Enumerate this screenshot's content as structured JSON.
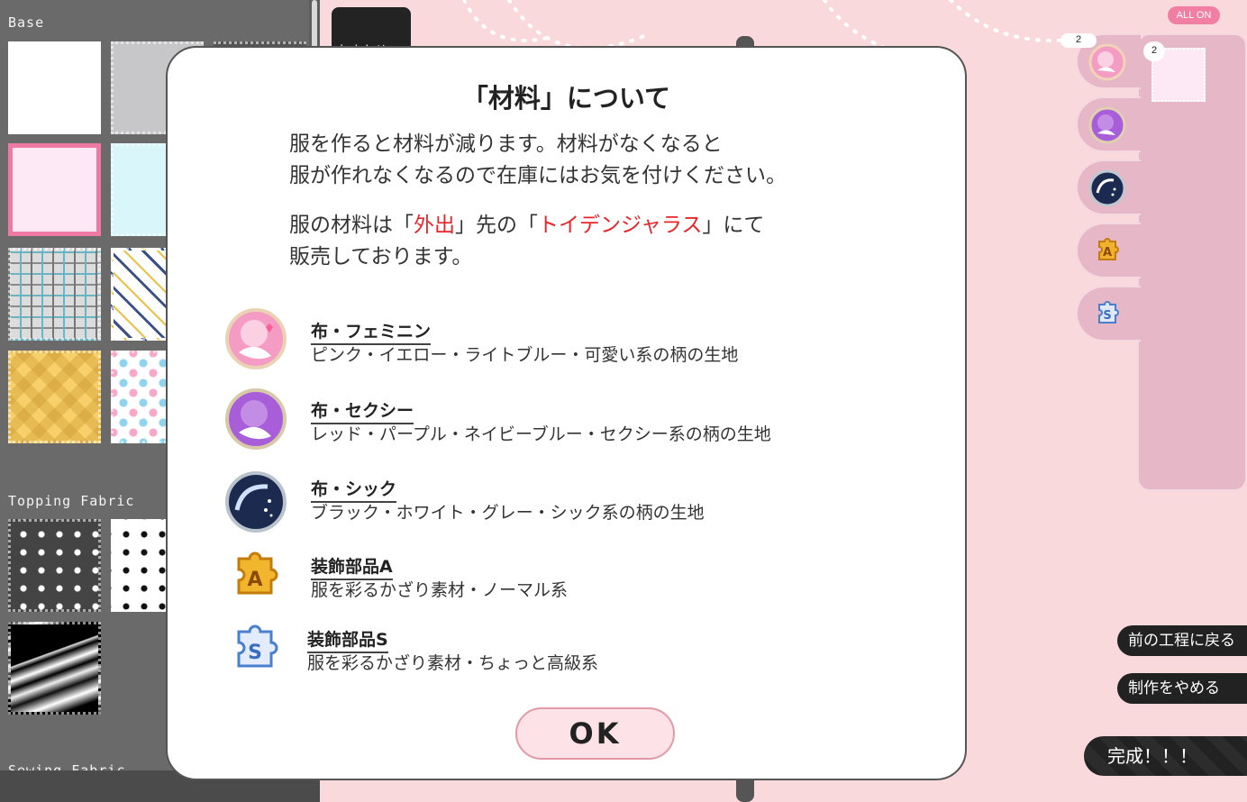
{
  "left_panel": {
    "base_label": "Base",
    "topping_label": "Topping Fabric",
    "sewing_label": "Sewing Fabric"
  },
  "top_thumb_label": "おまかせ",
  "all_on_label": "ALL ON",
  "material_tabs": [
    {
      "name": "布・フェミニン",
      "count": "2",
      "icon": "feminine-fabric-icon"
    },
    {
      "name": "布・セクシー",
      "icon": "sexy-fabric-icon"
    },
    {
      "name": "布・シック",
      "icon": "chic-fabric-icon"
    },
    {
      "name": "装飾部品A",
      "icon": "decor-part-a-icon"
    },
    {
      "name": "装飾部品S",
      "icon": "decor-part-s-icon"
    }
  ],
  "selected_swatch_count": "2",
  "side_buttons": {
    "back": "前の工程に戻る",
    "quit": "制作をやめる",
    "complete": "完成！！！"
  },
  "dialog": {
    "title": "「材料」について",
    "para1_line1": "服を作ると材料が減ります。材料がなくなると",
    "para1_line2": "服が作れなくなるので在庫にはお気を付けください。",
    "para2_pre": "服の材料は「",
    "para2_hl1": "外出",
    "para2_mid": "」先の「",
    "para2_hl2": "トイデンジャラス",
    "para2_post": "」にて",
    "para2_line2": "販売しております。",
    "items": [
      {
        "name": "布・フェミニン",
        "desc": "ピンク・イエロー・ライトブルー・可愛い系の柄の生地"
      },
      {
        "name": "布・セクシー",
        "desc": "レッド・パープル・ネイビーブルー・セクシー系の柄の生地"
      },
      {
        "name": "布・シック",
        "desc": "ブラック・ホワイト・グレー・シック系の柄の生地"
      },
      {
        "name": "装飾部品A",
        "desc": "服を彩るかざり素材・ノーマル系"
      },
      {
        "name": "装飾部品S",
        "desc": "服を彩るかざり素材・ちょっと高級系"
      }
    ],
    "ok_label": "OK"
  },
  "colors": {
    "accent_pink": "#ee7aa4",
    "highlight_red": "#e8262a",
    "panel_gray": "#6a6a6a",
    "bg_pink": "#f9d9dc"
  }
}
